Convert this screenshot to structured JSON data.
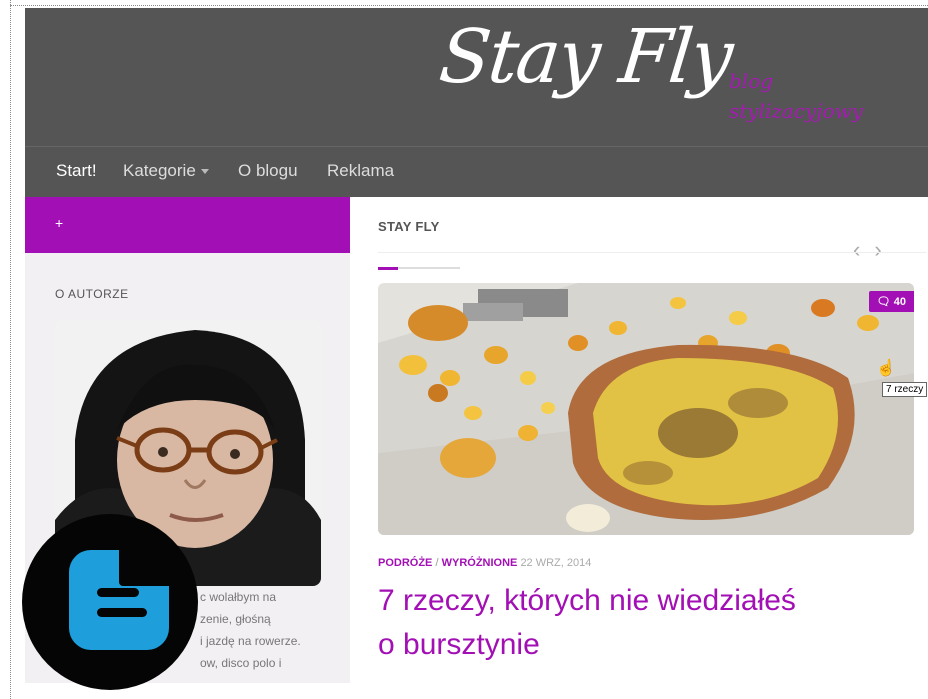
{
  "site": {
    "title": "Stay Fly",
    "tagline": "blog stylizacyjowy"
  },
  "nav": {
    "items": [
      "Start!",
      "Kategorie",
      "O blogu",
      "Reklama"
    ]
  },
  "sidebar": {
    "toggle": "+",
    "widget_title": "O AUTORZE",
    "text_lines": [
      "c wolałbym na",
      "zenie, głośną",
      "i jazdę na rowerze.",
      "ow, disco polo i"
    ]
  },
  "main": {
    "section_title": "STAY FLY",
    "featured": {
      "comments": "40",
      "categories": [
        "PODRÓŻE",
        "WYRÓŻNIONE"
      ],
      "date": "22 WRZ, 2014",
      "title": "7 rzeczy, których nie wiedziałeś o bursztynie",
      "tooltip": "7 rzeczy"
    }
  },
  "colors": {
    "accent": "#a20fb4",
    "header_bg": "#555555",
    "blogger_blue": "#1e9fdc"
  }
}
